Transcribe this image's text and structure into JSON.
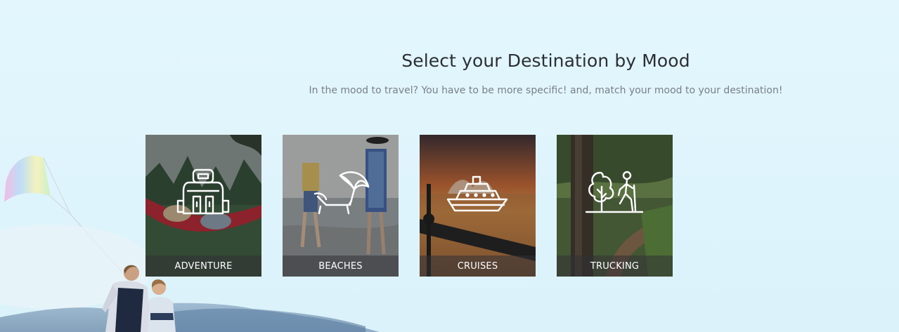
{
  "section": {
    "title": "Select your Destination by Mood",
    "subtitle": "In the mood to travel? You have to be more specific! and, match your mood to your destination!"
  },
  "cards": [
    {
      "label": "ADVENTURE",
      "icon": "backpack-icon"
    },
    {
      "label": "BEACHES",
      "icon": "beach-umbrella-icon"
    },
    {
      "label": "CRUISES",
      "icon": "cruise-ship-icon"
    },
    {
      "label": "TRUCKING",
      "icon": "hiking-trail-icon"
    }
  ],
  "colors": {
    "background": "#e0f5fd",
    "title": "#2b2f33",
    "subtitle": "#7b8086",
    "card_label": "#ffffff"
  }
}
